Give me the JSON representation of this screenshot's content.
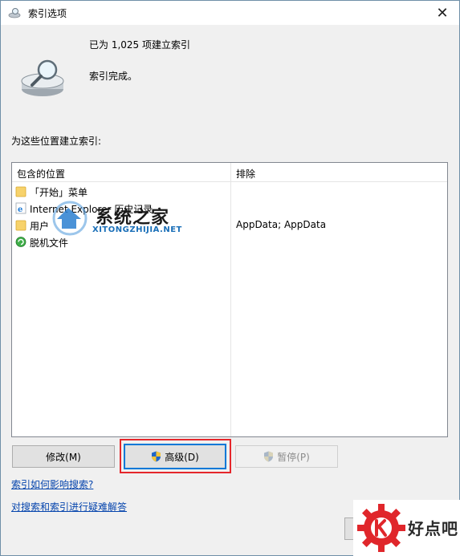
{
  "window": {
    "title": "索引选项",
    "close_glyph": "✕"
  },
  "status": {
    "count_text": "已为 1,025 项建立索引",
    "state_text": "索引完成。"
  },
  "locations_label": "为这些位置建立索引:",
  "list": {
    "columns": [
      "包含的位置",
      "排除"
    ],
    "rows": [
      {
        "icon": "folder-icon",
        "label": "「开始」菜单",
        "exclude": ""
      },
      {
        "icon": "ie-icon",
        "label": "Internet Explorer 历史记录",
        "exclude": ""
      },
      {
        "icon": "folder-icon",
        "label": "用户",
        "exclude": "AppData; AppData"
      },
      {
        "icon": "offline-files-icon",
        "label": "脱机文件",
        "exclude": ""
      }
    ]
  },
  "buttons": {
    "modify": "修改(M)",
    "advanced": "高级(D)",
    "pause": "暂停(P)"
  },
  "links": {
    "how_indexing": "索引如何影响搜索?",
    "troubleshoot": "对搜索和索引进行疑难解答"
  },
  "watermarks": {
    "center_title": "系统之家",
    "center_sub": "XITONGZHIJIA.NET",
    "badge_text": "好点吧"
  },
  "colors": {
    "accent": "#0078d7",
    "highlight": "#e5262b",
    "link": "#0645ad",
    "folder": "#f7d26b"
  }
}
